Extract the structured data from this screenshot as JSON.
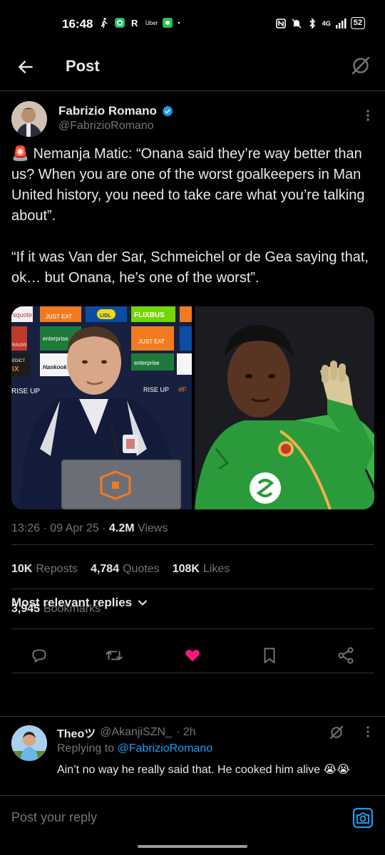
{
  "status_bar": {
    "time": "16:48",
    "battery": "52",
    "network": "4G",
    "icons": [
      "walk-icon",
      "app-icon",
      "r-app-icon",
      "uber-icon",
      "whatsapp-icon",
      "dot-icon",
      "nfc-icon",
      "mute-icon",
      "bluetooth-icon",
      "signal-icon"
    ],
    "uber_label": "Uber"
  },
  "header": {
    "title": "Post",
    "back_icon": "arrow-left-icon",
    "grok_icon": "grok-icon"
  },
  "post": {
    "author_name": "Fabrizio Romano",
    "handle": "@FabrizioRomano",
    "verified": true,
    "paragraph_1": "🚨 Nemanja Matic: “Onana said they’re way better than us? When you are one of the worst goalkeepers in Man United history, you need to take care what you’re talking about”.",
    "paragraph_2": "“If it was Van der Sar, Schmeichel or de Gea saying that, ok… but Onana, he’s one of the worst”.",
    "media": {
      "left_sponsors": [
        "squote",
        "JUST EAT",
        "LIDL",
        "FLIXBUS",
        "RAUSS",
        "enterprise",
        "Hankook",
        "EDICT",
        "RISE UP",
        "#F"
      ],
      "right_caption": ""
    },
    "time": "13:26",
    "date": "09 Apr 25",
    "views_count": "4.2M",
    "views_label": "Views",
    "reposts_count": "10K",
    "reposts_label": "Reposts",
    "quotes_count": "4,784",
    "quotes_label": "Quotes",
    "likes_count": "108K",
    "likes_label": "Likes",
    "bookmarks_count": "3,945",
    "bookmarks_label": "Bookmarks"
  },
  "actions": {
    "reply_icon": "reply-icon",
    "repost_icon": "repost-icon",
    "like_icon": "heart-icon",
    "bookmark_icon": "bookmark-icon",
    "share_icon": "share-icon",
    "like_color": "#f91880"
  },
  "replies": {
    "sort_label": "Most relevant replies",
    "items": [
      {
        "name": "Theoツ",
        "handle": "@AkanjiSZN_",
        "age": "· 2h",
        "replying_prefix": "Replying to",
        "replying_to": "@FabrizioRomano",
        "text": "Ain’t no way he really said that. He cooked him alive 😭😭"
      }
    ]
  },
  "compose": {
    "placeholder": "Post your reply",
    "camera_icon": "camera-icon",
    "accent": "#1d9bf0"
  }
}
